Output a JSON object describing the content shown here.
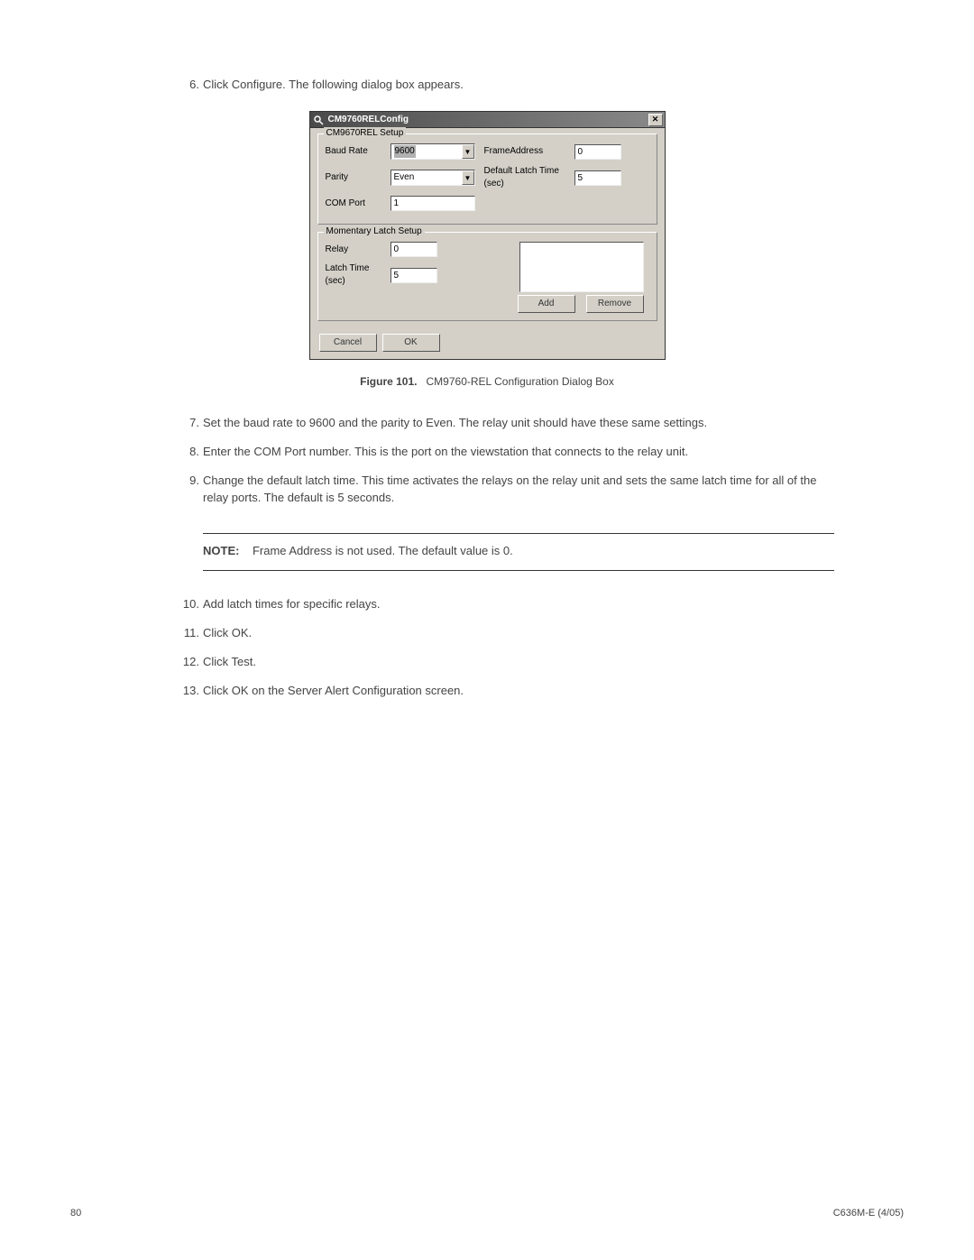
{
  "list": {
    "i6": {
      "num": "6.",
      "text": "Click Configure. The following dialog box appears."
    },
    "i7": {
      "num": "7.",
      "text": "Set the baud rate to 9600 and the parity to Even. The relay unit should have these same settings."
    },
    "i8": {
      "num": "8.",
      "text": "Enter the COM Port number. This is the port on the viewstation that connects to the relay unit."
    },
    "i9": {
      "num": "9.",
      "text": "Change the default latch time. This time activates the relays on the relay unit and sets the same latch time for all of the relay ports. The default is 5 seconds."
    },
    "i10": {
      "num": "10.",
      "text": "Add latch times for specific relays."
    },
    "i11": {
      "num": "11.",
      "text": "Click OK."
    },
    "i12": {
      "num": "12.",
      "text": "Click Test."
    },
    "i13": {
      "num": "13.",
      "text": "Click OK on the Server Alert Configuration screen."
    }
  },
  "dialog": {
    "title": "CM9760RELConfig",
    "group1": {
      "legend": "CM9670REL Setup",
      "baud_label": "Baud Rate",
      "baud_value": "9600",
      "parity_label": "Parity",
      "parity_value": "Even",
      "comport_label": "COM Port",
      "comport_value": "1",
      "frameaddr_label": "FrameAddress",
      "frameaddr_value": "0",
      "deflatch_label": "Default Latch Time (sec)",
      "deflatch_value": "5"
    },
    "group2": {
      "legend": "Momentary Latch Setup",
      "relay_label": "Relay",
      "relay_value": "0",
      "latchtime_label": "Latch Time (sec)",
      "latchtime_value": "5",
      "add_label": "Add",
      "remove_label": "Remove"
    },
    "cancel_label": "Cancel",
    "ok_label": "OK"
  },
  "caption": {
    "prefix": "Figure 101.",
    "text": "CM9760-REL Configuration Dialog Box"
  },
  "note": {
    "prefix": "NOTE:",
    "text": "Frame Address is not used. The default value is 0."
  },
  "footer": {
    "page": "80",
    "doc": "C636M-E (4/05)"
  }
}
